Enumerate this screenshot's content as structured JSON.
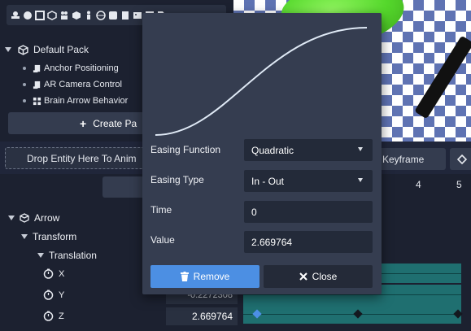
{
  "toolbar": {
    "icons": [
      "entities-icon",
      "sphere-icon",
      "film-icon",
      "hexagon-icon",
      "people-icon",
      "cube-icon",
      "person-icon",
      "globe-icon",
      "square-icon",
      "document-icon",
      "image-icon",
      "text-icon",
      "tag-icon"
    ]
  },
  "pack": {
    "title": "Default Pack",
    "items": [
      {
        "label": "Anchor Positioning",
        "icon": "script-icon"
      },
      {
        "label": "AR Camera Control",
        "icon": "script-icon"
      },
      {
        "label": "Brain Arrow Behavior",
        "icon": "behavior-graph-icon"
      }
    ],
    "create_label": "Create Pa"
  },
  "timeline": {
    "drop_label": "Drop Entity Here To Anim",
    "keyframe_label": "d Keyframe",
    "ticks": [
      "4",
      "5"
    ],
    "hierarchy": {
      "entity": "Arrow",
      "component": "Transform",
      "property": "Translation",
      "axes": [
        {
          "label": "X",
          "value": ""
        },
        {
          "label": "Y",
          "value": "-0.2272308"
        },
        {
          "label": "Z",
          "value": "2.669764"
        }
      ]
    }
  },
  "modal": {
    "easing_function_label": "Easing Function",
    "easing_function_value": "Quadratic",
    "easing_type_label": "Easing Type",
    "easing_type_value": "In - Out",
    "time_label": "Time",
    "time_value": "0",
    "value_label": "Value",
    "value_value": "2.669764",
    "remove_label": "Remove",
    "close_label": "Close"
  },
  "colors": {
    "accent": "#4c8fe3",
    "track": "#1f6f70",
    "panel": "#353d50",
    "background": "#1c2130"
  }
}
